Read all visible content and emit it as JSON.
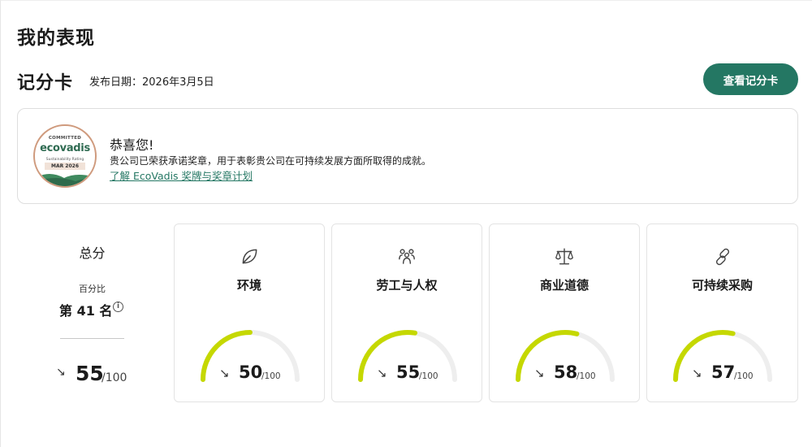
{
  "page": {
    "title": "我的表现"
  },
  "scorecard": {
    "title": "记分卡",
    "published": "发布日期：2026年3月5日",
    "view_button": "查看记分卡"
  },
  "banner": {
    "badge": {
      "top_text": "COMMITTED",
      "logo": "ecovadis",
      "subtitle": "Sustainability Rating",
      "date": "MAR 2026"
    },
    "heading": "恭喜您!",
    "message": "贵公司已荣获承诺奖章，用于表彰贵公司在可持续发展方面所取得的成就。",
    "link": "了解 EcoVadis 奖牌与奖章计划"
  },
  "overall": {
    "title": "总分",
    "percentile_label": "百分比",
    "rank": "第 41 名",
    "info_icon": "info-icon",
    "trend_icon": "arrow-down-right-icon",
    "score": "55",
    "max": "/100"
  },
  "themes": [
    {
      "label": "环境",
      "icon": "leaf-icon",
      "score": "50",
      "max": "/100",
      "value": 50
    },
    {
      "label": "劳工与人权",
      "icon": "people-icon",
      "score": "55",
      "max": "/100",
      "value": 55
    },
    {
      "label": "商业道德",
      "icon": "scales-icon",
      "score": "58",
      "max": "/100",
      "value": 58
    },
    {
      "label": "可持续采购",
      "icon": "link-icon",
      "score": "57",
      "max": "/100",
      "value": 57
    }
  ],
  "colors": {
    "accent": "#247763",
    "gauge_fill": "#c5d800",
    "gauge_track": "#eeeeee"
  }
}
